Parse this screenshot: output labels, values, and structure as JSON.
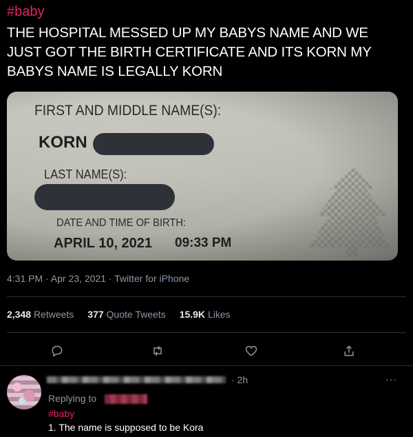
{
  "tweet": {
    "hashtag": "#baby",
    "text": "THE HOSPITAL MESSED UP MY BABYS NAME AND WE JUST GOT THE BIRTH CERTIFICATE AND ITS KORN MY BABYS NAME IS LEGALLY KORN",
    "meta": "4:31 PM · Apr 23, 2021 · Twitter for iPhone"
  },
  "certificate": {
    "first_middle_label": "FIRST AND MIDDLE NAME(S):",
    "first_name_value": "KORN",
    "last_name_label": "LAST NAME(S):",
    "date_label": "DATE AND TIME OF BIRTH:",
    "date_value": "APRIL 10, 2021",
    "time_value": "09:33 PM"
  },
  "stats": {
    "retweets_count": "2,348",
    "retweets_label": "Retweets",
    "quotes_count": "377",
    "quotes_label": "Quote Tweets",
    "likes_count": "15.9K",
    "likes_label": "Likes"
  },
  "actions": [
    {
      "icon": "reply-icon"
    },
    {
      "icon": "retweet-icon"
    },
    {
      "icon": "like-icon"
    },
    {
      "icon": "share-icon"
    }
  ],
  "reply": {
    "time": "· 2h",
    "more": "···",
    "replying_to": "Replying to",
    "hashtag": "#baby",
    "text": "1. The name is supposed to be Kora"
  },
  "colors": {
    "background": "#000000",
    "text": "#e7e9ea",
    "muted": "#8b98a5",
    "hashtag": "#e0245e",
    "divider": "#2f3336"
  }
}
